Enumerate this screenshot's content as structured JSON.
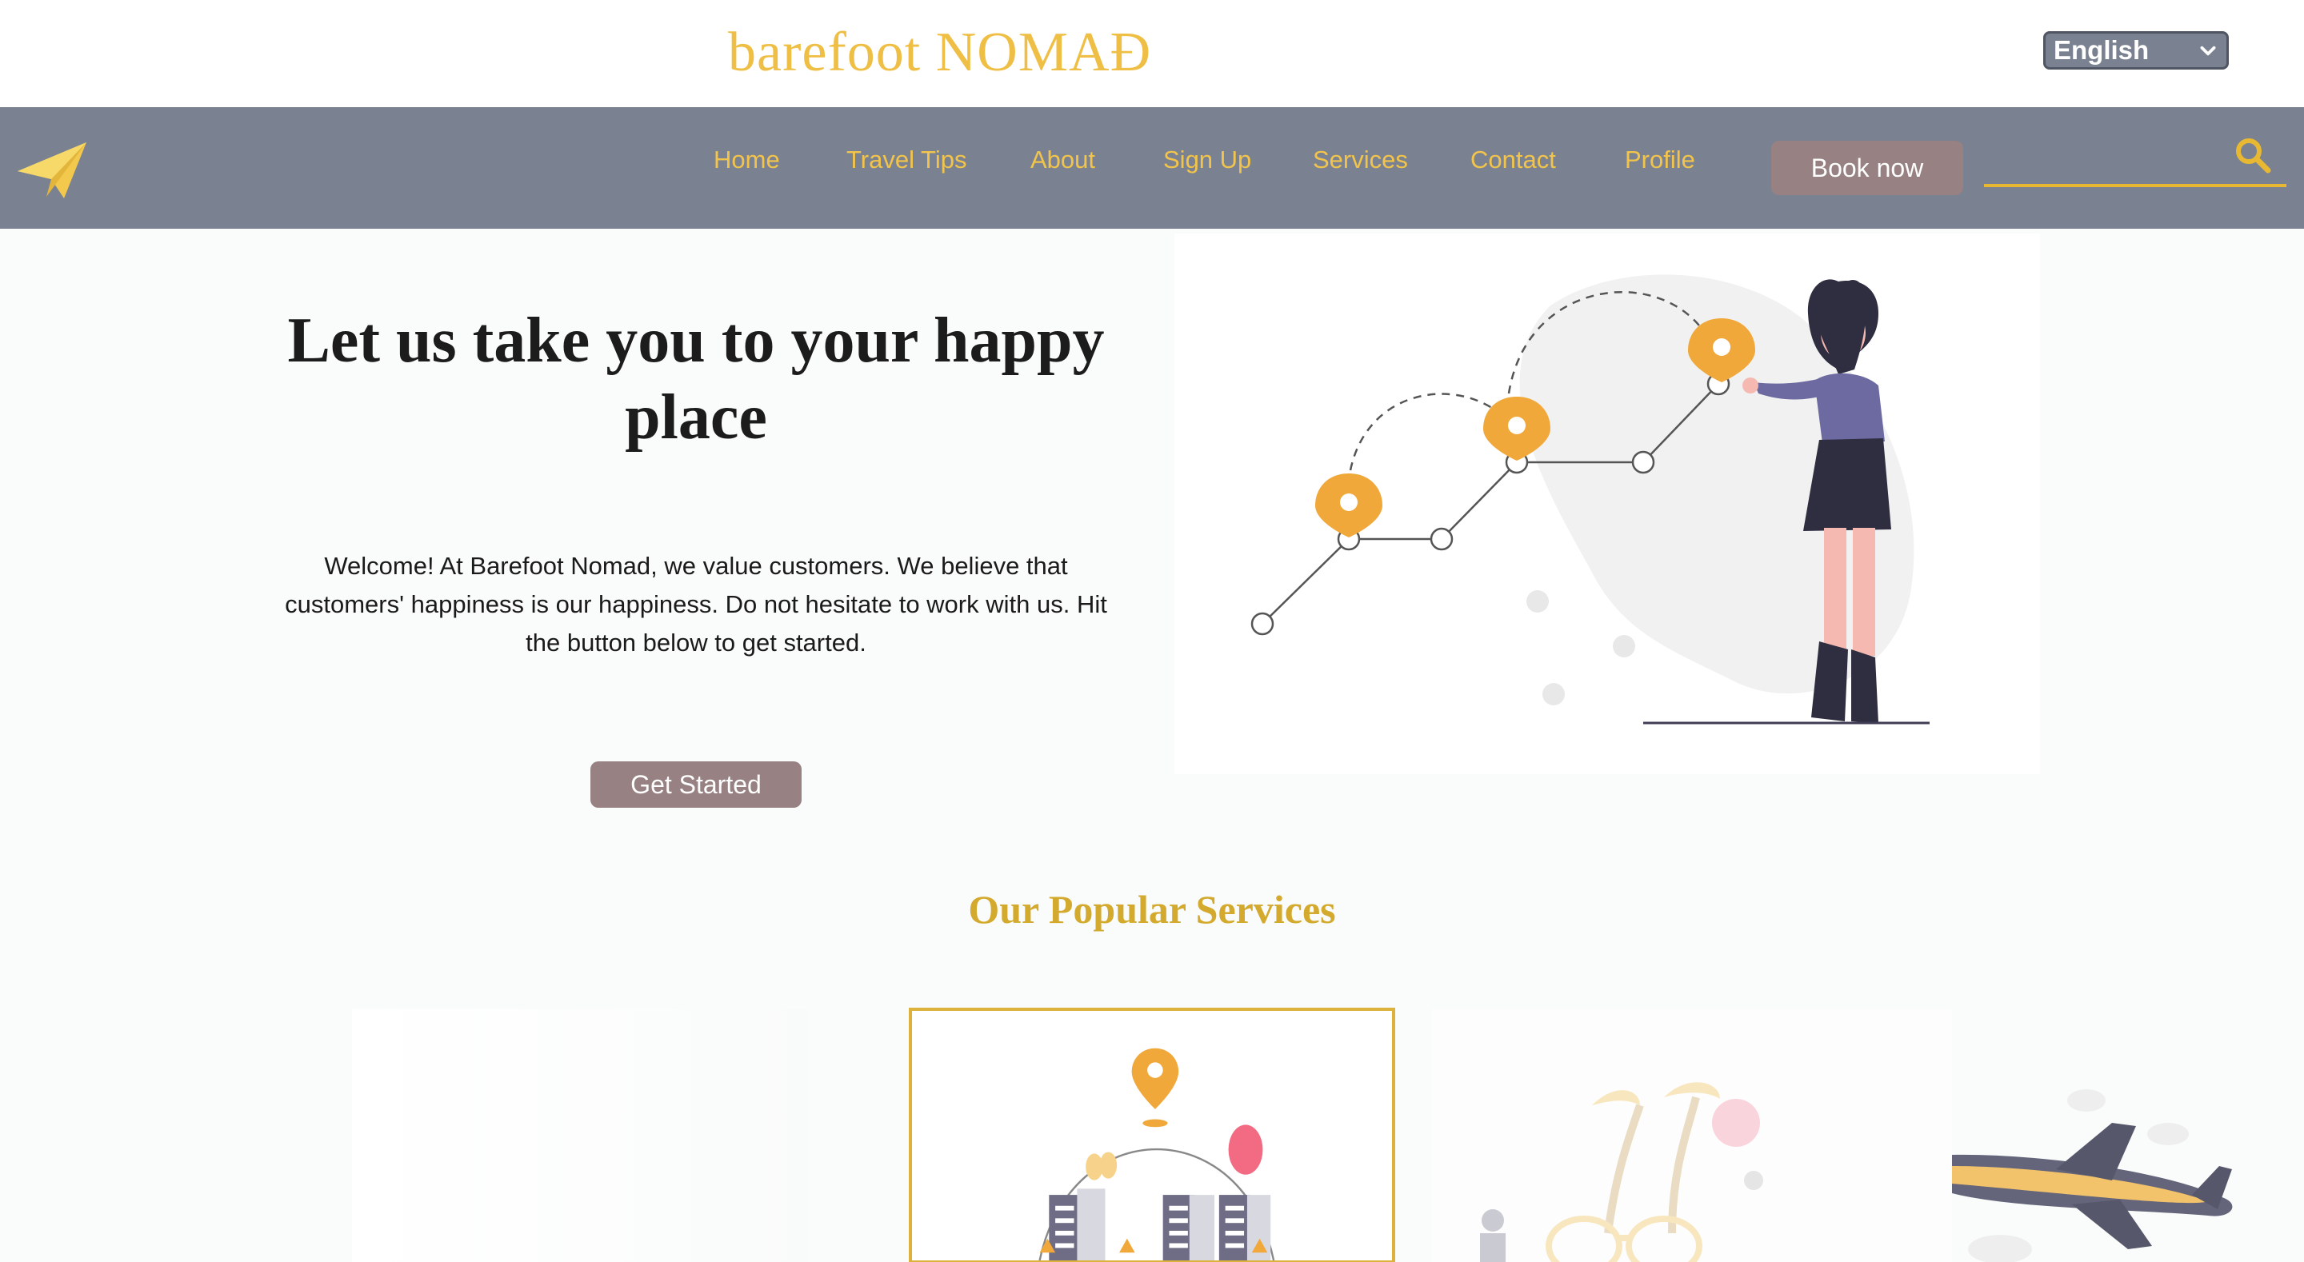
{
  "brand": {
    "name": "barefoot NOMAĐ"
  },
  "language": {
    "selected": "English"
  },
  "nav": {
    "items": [
      {
        "label": "Home"
      },
      {
        "label": "Travel Tips"
      },
      {
        "label": "About"
      },
      {
        "label": "Sign Up"
      },
      {
        "label": "Services"
      },
      {
        "label": "Contact"
      },
      {
        "label": "Profile"
      }
    ],
    "book_label": "Book now",
    "search_placeholder": ""
  },
  "hero": {
    "title": "Let us take you to your happy place",
    "text": "Welcome! At Barefoot Nomad, we value customers. We believe that customers' happiness is our happiness. Do not hesitate to work with us. Hit the button below to get started.",
    "cta_label": "Get Started"
  },
  "services": {
    "title": "Our Popular Services"
  },
  "colors": {
    "accent": "#efbf45",
    "nav_bg": "#7a8291",
    "button_bg": "#978182",
    "pin": "#f0a83a"
  }
}
